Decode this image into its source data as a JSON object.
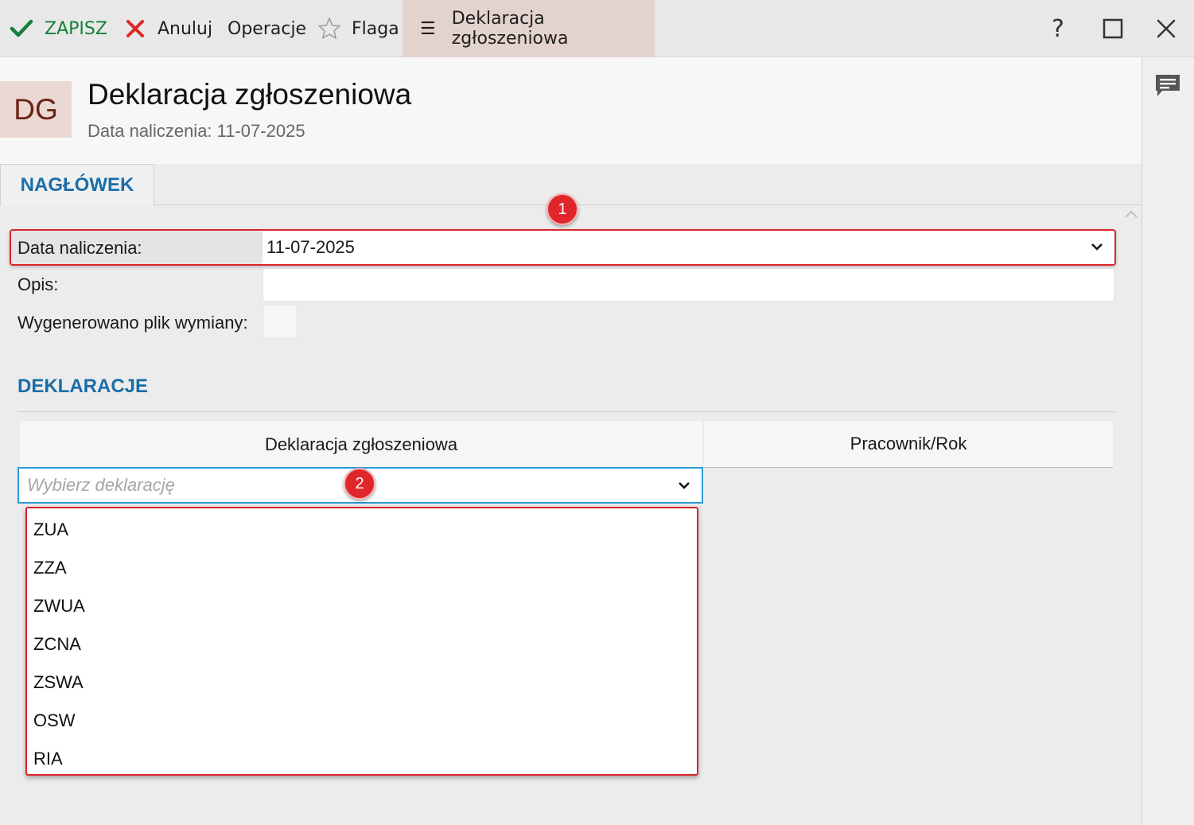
{
  "toolbar": {
    "save_label": "ZAPISZ",
    "cancel_label": "Anuluj",
    "operations_label": "Operacje",
    "flag_label": "Flaga",
    "tab_label": "Deklaracja zgłoszeniowa",
    "help_label": "?"
  },
  "header": {
    "avatar": "DG",
    "title": "Deklaracja zgłoszeniowa",
    "subtitle": "Data naliczenia: 11-07-2025"
  },
  "tabs": [
    {
      "label": "NAGŁÓWEK"
    }
  ],
  "badges": [
    "1",
    "2"
  ],
  "form": {
    "date_label": "Data naliczenia:",
    "date_value": "11-07-2025",
    "opis_label": "Opis:",
    "opis_value": "",
    "generated_label": "Wygenerowano plik wymiany:"
  },
  "declarations": {
    "title": "DEKLARACJE",
    "columns": [
      "Deklaracja zgłoszeniowa",
      "Pracownik/Rok"
    ],
    "select_placeholder": "Wybierz deklarację",
    "options": [
      "ZUA",
      "ZZA",
      "ZWUA",
      "ZCNA",
      "ZSWA",
      "OSW",
      "RIA"
    ]
  },
  "colors": {
    "save_green": "#15813a",
    "cancel_red": "#e0262b",
    "accent_blue": "#1a6ea8",
    "focus_blue": "#2a9bd6",
    "highlight_red": "#d9262c",
    "active_tab_bg": "#e3d3cd"
  },
  "icons": [
    "check-icon",
    "x-icon",
    "star-icon",
    "hamburger-icon",
    "help-icon",
    "maximize-icon",
    "close-icon",
    "comment-icon",
    "chevron-down-icon",
    "chevron-up-icon"
  ]
}
